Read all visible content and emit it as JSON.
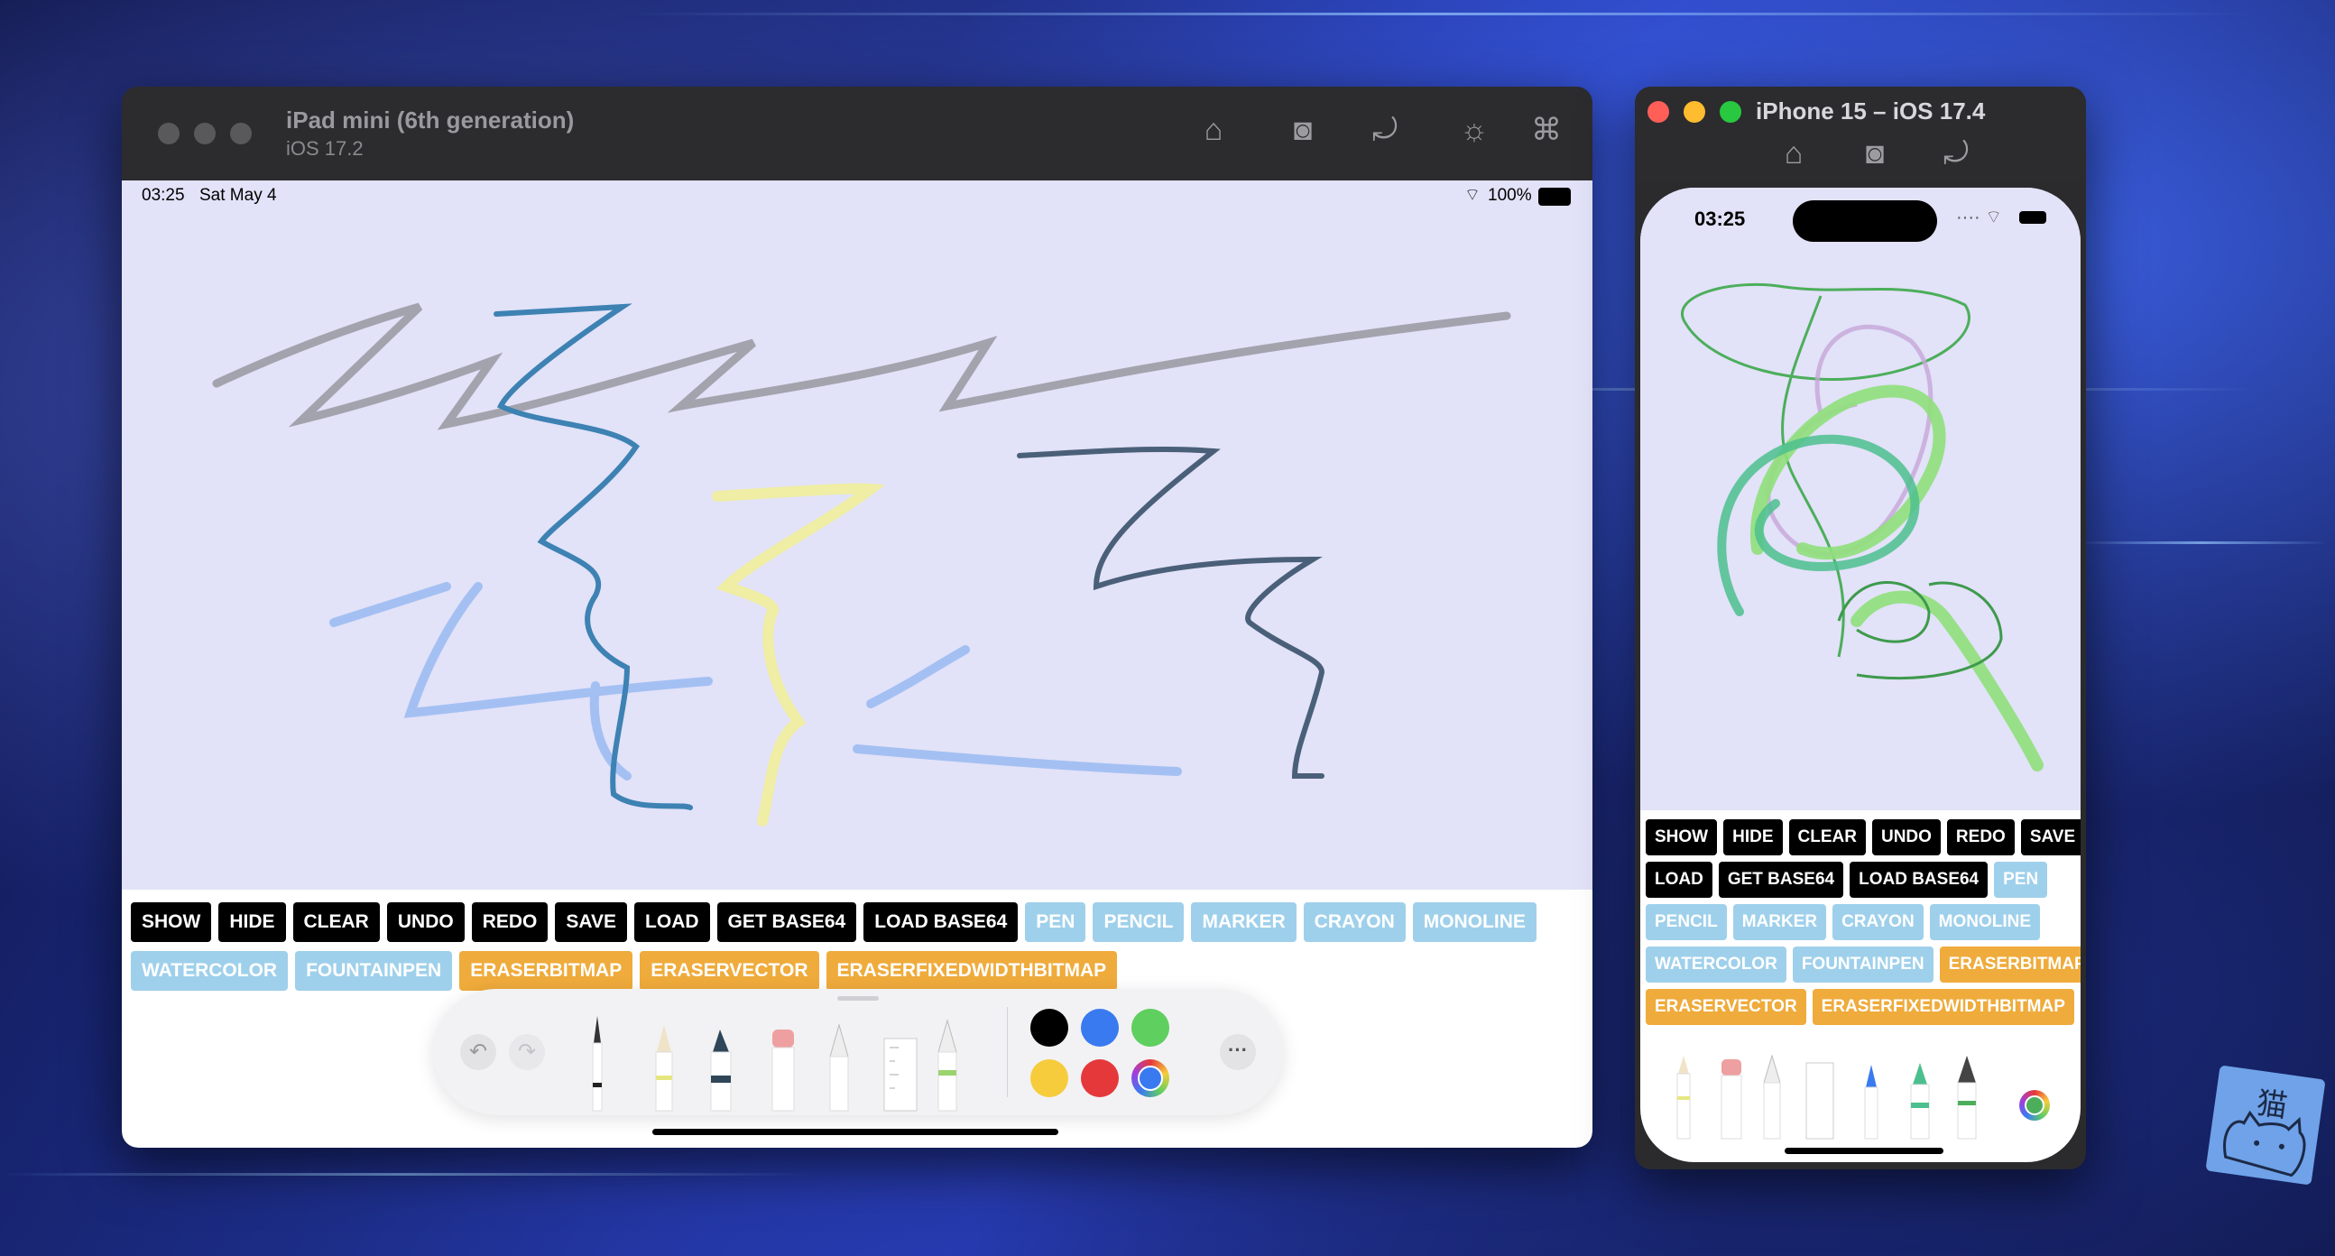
{
  "ipad": {
    "window_title": "iPad mini (6th generation)",
    "window_subtitle": "iOS 17.2",
    "toolbar_icons": [
      "home-icon",
      "screenshot-icon",
      "rotate-icon",
      "brightness-icon",
      "command-icon"
    ],
    "status_time": "03:25",
    "status_date": "Sat May 4",
    "battery": "100%",
    "row1": [
      {
        "label": "SHOW",
        "style": "black"
      },
      {
        "label": "HIDE",
        "style": "black"
      },
      {
        "label": "CLEAR",
        "style": "black"
      },
      {
        "label": "UNDO",
        "style": "black"
      },
      {
        "label": "REDO",
        "style": "black"
      },
      {
        "label": "SAVE",
        "style": "black"
      },
      {
        "label": "LOAD",
        "style": "black"
      },
      {
        "label": "GET BASE64",
        "style": "black"
      },
      {
        "label": "LOAD BASE64",
        "style": "black"
      },
      {
        "label": "PEN",
        "style": "blue"
      },
      {
        "label": "PENCIL",
        "style": "blue"
      },
      {
        "label": "MARKER",
        "style": "blue"
      },
      {
        "label": "CRAYON",
        "style": "blue"
      },
      {
        "label": "MONOLINE",
        "style": "blue"
      }
    ],
    "row2": [
      {
        "label": "WATERCOLOR",
        "style": "blue"
      },
      {
        "label": "FOUNTAINPEN",
        "style": "blue"
      },
      {
        "label": "ERASERBITMAP",
        "style": "orange"
      },
      {
        "label": "ERASERVECTOR",
        "style": "orange"
      },
      {
        "label": "ERASERFIXEDWIDTHBITMAP",
        "style": "orange"
      }
    ],
    "palette_colors": [
      "#000000",
      "#3a7af0",
      "#5fcf5f",
      "#f6cc3c",
      "#e5383b",
      "multicolor"
    ]
  },
  "iphone": {
    "window_title": "iPhone 15 – iOS 17.4",
    "toolbar_icons": [
      "home-icon",
      "screenshot-icon",
      "rotate-icon"
    ],
    "status_time": "03:25",
    "rows": [
      [
        {
          "label": "SHOW",
          "style": "black"
        },
        {
          "label": "HIDE",
          "style": "black"
        },
        {
          "label": "CLEAR",
          "style": "black"
        },
        {
          "label": "UNDO",
          "style": "black"
        },
        {
          "label": "REDO",
          "style": "black"
        },
        {
          "label": "SAVE",
          "style": "black"
        }
      ],
      [
        {
          "label": "LOAD",
          "style": "black"
        },
        {
          "label": "GET BASE64",
          "style": "black"
        },
        {
          "label": "LOAD BASE64",
          "style": "black"
        },
        {
          "label": "PEN",
          "style": "blue"
        }
      ],
      [
        {
          "label": "PENCIL",
          "style": "blue"
        },
        {
          "label": "MARKER",
          "style": "blue"
        },
        {
          "label": "CRAYON",
          "style": "blue"
        },
        {
          "label": "MONOLINE",
          "style": "blue"
        }
      ],
      [
        {
          "label": "WATERCOLOR",
          "style": "blue"
        },
        {
          "label": "FOUNTAINPEN",
          "style": "blue"
        },
        {
          "label": "ERASERBITMAP",
          "style": "orange"
        }
      ],
      [
        {
          "label": "ERASERVECTOR",
          "style": "orange"
        },
        {
          "label": "ERASERFIXEDWIDTHBITMAP",
          "style": "orange"
        }
      ]
    ]
  },
  "sticker_text": "猫"
}
